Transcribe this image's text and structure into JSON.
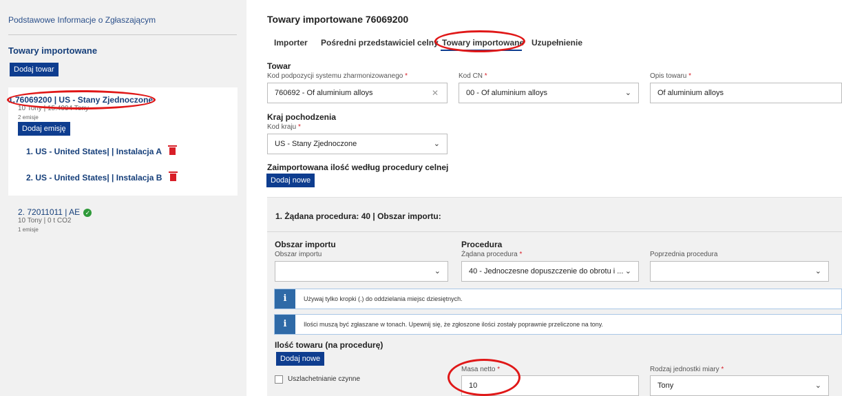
{
  "sidebar": {
    "applicant_link": "Podstawowe Informacje o Zgłaszającym",
    "section_title": "Towary importowane",
    "add_goods_button": "Dodaj towar",
    "goods": [
      {
        "title": "1.76069200 | US - Stany Zjednoczone",
        "summary": "10 Tony | 15.4994 Tony",
        "emissions_count": "2 emisje",
        "add_emission_button": "Dodaj emisję",
        "emissions": [
          {
            "label": "1. US - United States| | Instalacja A"
          },
          {
            "label": "2. US - United States| | Instalacja B"
          }
        ]
      },
      {
        "title": "2. 72011011 | AE",
        "summary": "10 Tony | 0 t CO2",
        "emissions_count": "1 emisje"
      }
    ]
  },
  "main": {
    "title": "Towary importowane 76069200",
    "tabs": [
      {
        "label": "Importer",
        "active": false
      },
      {
        "label": "Pośredni przedstawiciel celny",
        "active": false
      },
      {
        "label": "Towary importowane",
        "active": true
      },
      {
        "label": "Uzupełnienie",
        "active": false
      }
    ],
    "goods_section": {
      "title": "Towar",
      "hs_label": "Kod podpozycji systemu zharmonizowanego",
      "hs_value": "760692 - Of aluminium alloys",
      "cn_label": "Kod CN",
      "cn_value": "00 - Of aluminium alloys",
      "desc_label": "Opis towaru",
      "desc_value": "Of aluminium alloys"
    },
    "origin_section": {
      "title": "Kraj pochodzenia",
      "country_label": "Kod kraju",
      "country_value": "US - Stany Zjednoczone"
    },
    "customs_section": {
      "title": "Zaimportowana ilość według procedury celnej",
      "add_new_button": "Dodaj nowe"
    },
    "procedure_panel": {
      "header": "1. Żądana procedura: 40 | Obszar importu:",
      "import_area_title": "Obszar importu",
      "import_area_label": "Obszar importu",
      "import_area_value": "",
      "procedure_title": "Procedura",
      "requested_label": "Żądana procedura",
      "requested_value": "40 - Jednoczesne dopuszczenie do obrotu i ...",
      "previous_label": "Poprzednia procedura",
      "previous_value": "",
      "info1": "Używaj tylko kropki (.) do oddzielania miejsc dziesiętnych.",
      "info2": "Ilości muszą być zgłaszane w tonach. Upewnij się, że zgłoszone ilości zostały poprawnie przeliczone na tony.",
      "quantity_title": "Ilość towaru (na procedurę)",
      "add_new_button": "Dodaj nowe",
      "inward_processing_label": "Uszlachetnianie czynne",
      "net_mass_label": "Masa netto",
      "net_mass_value": "10",
      "unit_label": "Rodzaj jednostki miary",
      "unit_value": "Tony"
    }
  },
  "icons": {
    "info": "info-icon",
    "dropdown": "chevron-down-icon",
    "clear": "close-icon",
    "delete": "trash-icon",
    "valid": "check-circle-icon"
  },
  "colors": {
    "primary_button": "#0e3d8f",
    "link": "#163f7a",
    "delete": "#d81e27",
    "success": "#2f9a3a",
    "info": "#2f6aa7",
    "annotation": "#e01818"
  }
}
